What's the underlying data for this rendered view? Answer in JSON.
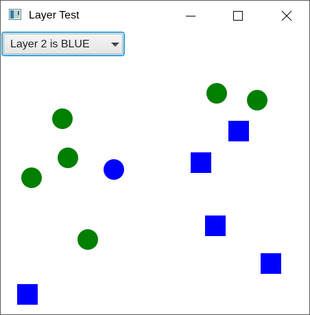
{
  "window": {
    "title": "Layer Test"
  },
  "layer_select": {
    "selected": "Layer 2 is BLUE"
  },
  "colors": {
    "green": "#007f00",
    "blue": "#0000ff",
    "focus_ring": "#2ea8e6"
  }
}
